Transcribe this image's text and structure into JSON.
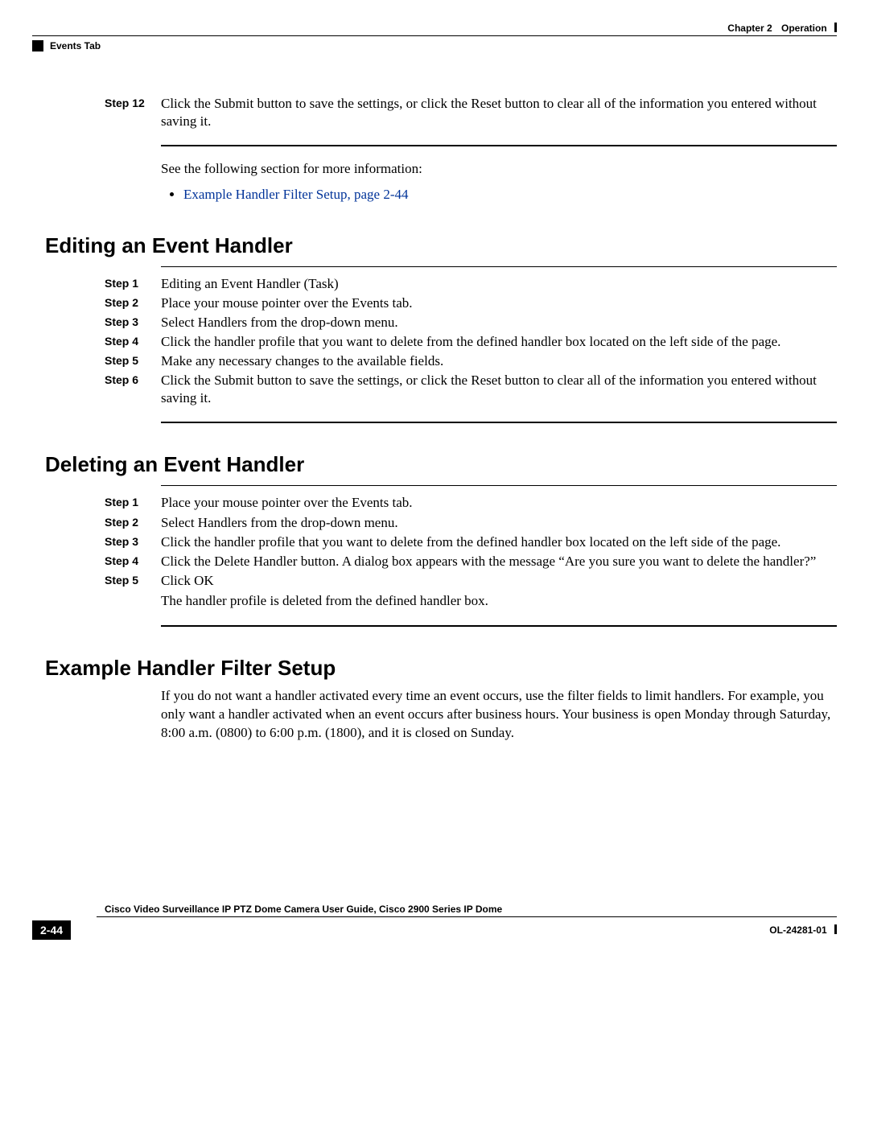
{
  "header": {
    "chapter_label": "Chapter 2",
    "chapter_title": "Operation",
    "section_label": "Events Tab"
  },
  "intro_block": {
    "step_label": "Step 12",
    "step_text": "Click the Submit button to save the settings, or click the Reset button to clear all of the information you entered without saving it.",
    "note": "See the following section for more information:",
    "link_text": "Example Handler Filter Setup, page 2-44"
  },
  "sections": {
    "editing": {
      "heading": "Editing an Event Handler",
      "steps": [
        {
          "label": "Step 1",
          "text": "Editing an Event Handler (Task)"
        },
        {
          "label": "Step 2",
          "text": "Place your mouse pointer over the Events tab."
        },
        {
          "label": "Step 3",
          "text": "Select Handlers from the drop-down menu."
        },
        {
          "label": "Step 4",
          "text": "Click the handler profile that you want to delete from the defined handler box located on the left side of the page."
        },
        {
          "label": "Step 5",
          "text": "Make any necessary changes to the available fields."
        },
        {
          "label": "Step 6",
          "text": "Click the Submit button to save the settings, or click the Reset button to clear all of the information you entered without saving it."
        }
      ]
    },
    "deleting": {
      "heading": "Deleting an Event Handler",
      "steps": [
        {
          "label": "Step 1",
          "text": "Place your mouse pointer over the Events tab."
        },
        {
          "label": "Step 2",
          "text": "Select Handlers from the drop-down menu."
        },
        {
          "label": "Step 3",
          "text": "Click the handler profile that you want to delete from the defined handler box located on the left side of the page."
        },
        {
          "label": "Step 4",
          "text": "Click the Delete Handler button. A dialog box appears with the message “Are you sure you want to delete the handler?”"
        },
        {
          "label": "Step 5",
          "text": "Click OK"
        }
      ],
      "after_text": "The handler profile is deleted from the defined handler box."
    },
    "example": {
      "heading": "Example Handler Filter Setup",
      "body": "If you do not want a handler activated every time an event occurs, use the filter fields to limit handlers. For example, you only want a handler activated when an event occurs after business hours. Your business is open Monday through Saturday, 8:00 a.m. (0800) to 6:00 p.m. (1800), and it is closed on Sunday."
    }
  },
  "footer": {
    "title": "Cisco Video Surveillance IP PTZ Dome Camera User Guide, Cisco 2900 Series IP Dome",
    "page": "2-44",
    "doc_id": "OL-24281-01"
  }
}
